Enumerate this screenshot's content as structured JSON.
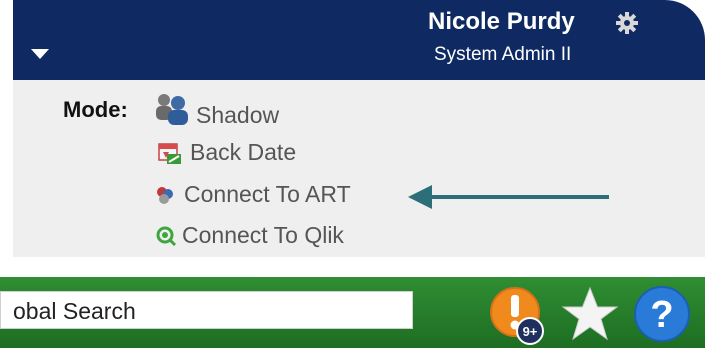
{
  "header": {
    "user_name": "Nicole Purdy",
    "user_role": "System Admin II",
    "icons": {
      "menu": "chevron-down-icon",
      "settings": "gear-icon"
    }
  },
  "mode_panel": {
    "label": "Mode:",
    "items": [
      {
        "label": "Shadow",
        "icon": "users-icon"
      },
      {
        "label": "Back Date",
        "icon": "calendar-icon"
      },
      {
        "label": "Connect To ART",
        "icon": "art-icon"
      },
      {
        "label": "Connect To Qlik",
        "icon": "qlik-icon"
      }
    ]
  },
  "search_bar": {
    "search_value": "obal Search",
    "alert_badge": "9+",
    "icons": {
      "alerts": "alert-icon",
      "favorites": "star-icon",
      "help": "help-icon"
    }
  },
  "colors": {
    "header_bg": "#0f2a63",
    "panel_bg": "#efefef",
    "arrow": "#2d6f78",
    "search_bar_bg": "#2a862e",
    "alert_orange": "#f08a1c",
    "help_blue": "#2a7bd8"
  }
}
